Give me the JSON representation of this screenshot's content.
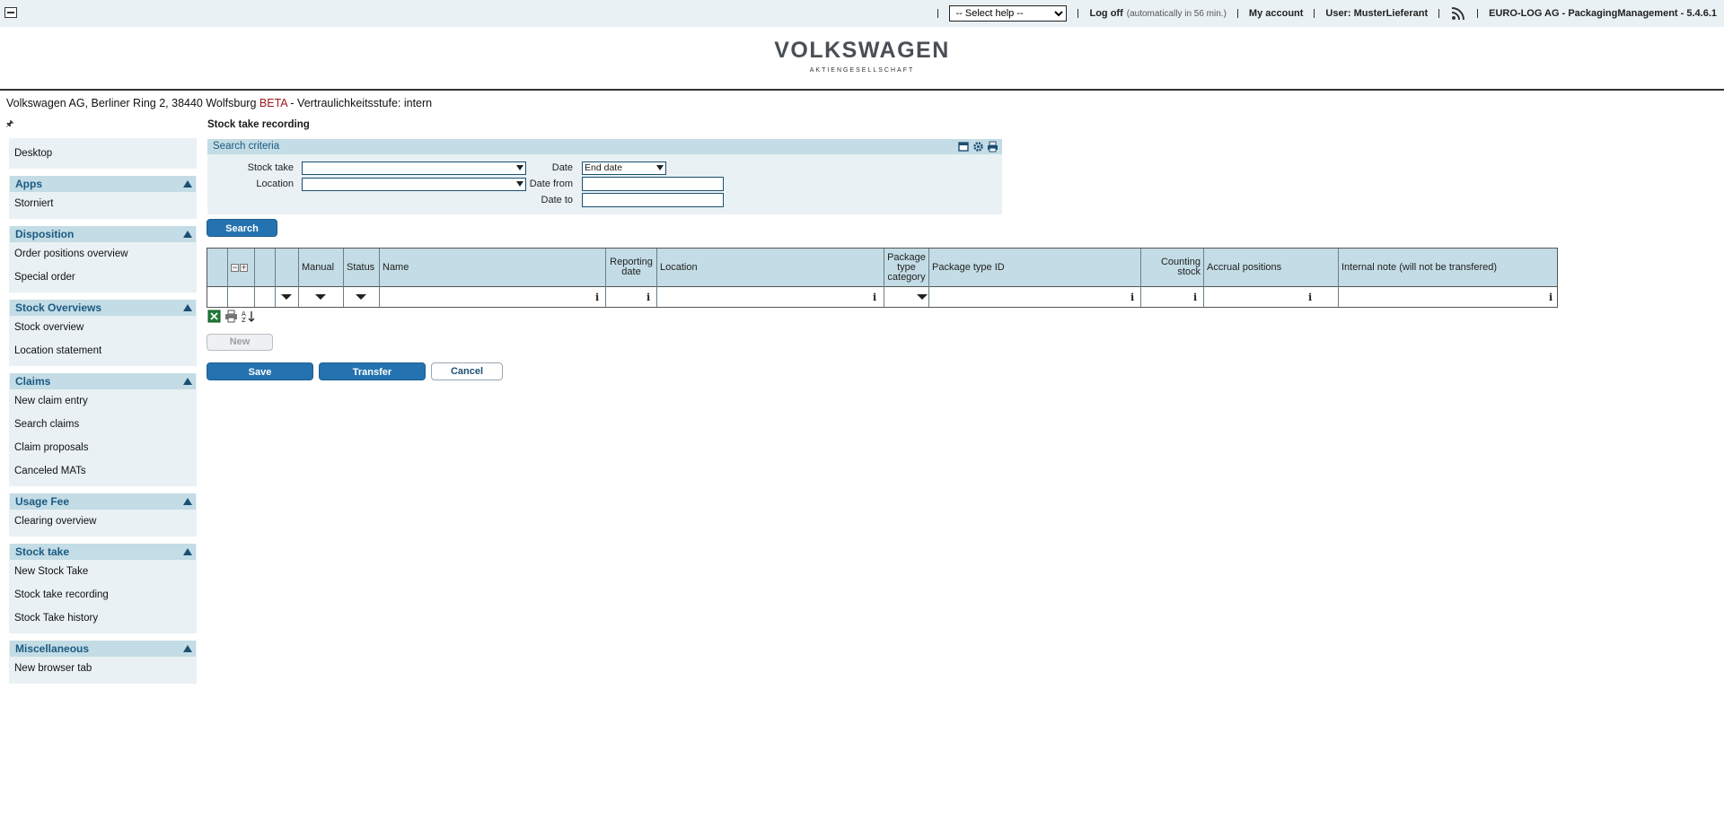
{
  "topbar": {
    "help_select": "-- Select help --",
    "logoff": "Log off",
    "logoff_note": "(automatically in 56 min.)",
    "my_account": "My account",
    "user": "User: MusterLieferant",
    "app_name": "EURO-LOG AG - PackagingManagement - 5.4.6.1"
  },
  "logo": {
    "main": "VOLKSWAGEN",
    "sub": "AKTIENGESELLSCHAFT"
  },
  "orgline": {
    "address": "Volkswagen AG, Berliner Ring 2, 38440 Wolfsburg",
    "beta": "BETA",
    "rest": "- Vertraulichkeitsstufe: intern"
  },
  "sidebar": {
    "desktop": "Desktop",
    "sections": [
      {
        "title": "Apps",
        "items": [
          "Storniert"
        ]
      },
      {
        "title": "Disposition",
        "items": [
          "Order positions overview",
          "Special order"
        ]
      },
      {
        "title": "Stock Overviews",
        "items": [
          "Stock overview",
          "Location statement"
        ]
      },
      {
        "title": "Claims",
        "items": [
          "New claim entry",
          "Search claims",
          "Claim proposals",
          "Canceled MATs"
        ]
      },
      {
        "title": "Usage Fee",
        "items": [
          "Clearing overview"
        ]
      },
      {
        "title": "Stock take",
        "items": [
          "New Stock Take",
          "Stock take recording",
          "Stock Take history"
        ]
      },
      {
        "title": "Miscellaneous",
        "items": [
          "New browser tab"
        ]
      }
    ]
  },
  "main": {
    "title": "Stock take recording",
    "search_panel": {
      "title": "Search criteria",
      "stock_take_label": "Stock take",
      "location_label": "Location",
      "date_label": "Date",
      "date_value": "End date",
      "date_from_label": "Date from",
      "date_to_label": "Date to"
    },
    "search_button": "Search",
    "columns": {
      "manual": "Manual",
      "status": "Status",
      "name": "Name",
      "reporting_date": "Reporting date",
      "location": "Location",
      "package_type_category": "Package type category",
      "package_type_id": "Package type ID",
      "counting_stock": "Counting stock",
      "accrual_positions": "Accrual positions",
      "internal_note": "Internal note (will not be transfered)"
    },
    "new_button": "New",
    "save_button": "Save",
    "transfer_button": "Transfer",
    "cancel_button": "Cancel"
  },
  "colors": {
    "accent": "#2473b0",
    "header_bg": "#c3dce5",
    "panel_bg": "#e9f1f4",
    "beta": "#a01820"
  }
}
